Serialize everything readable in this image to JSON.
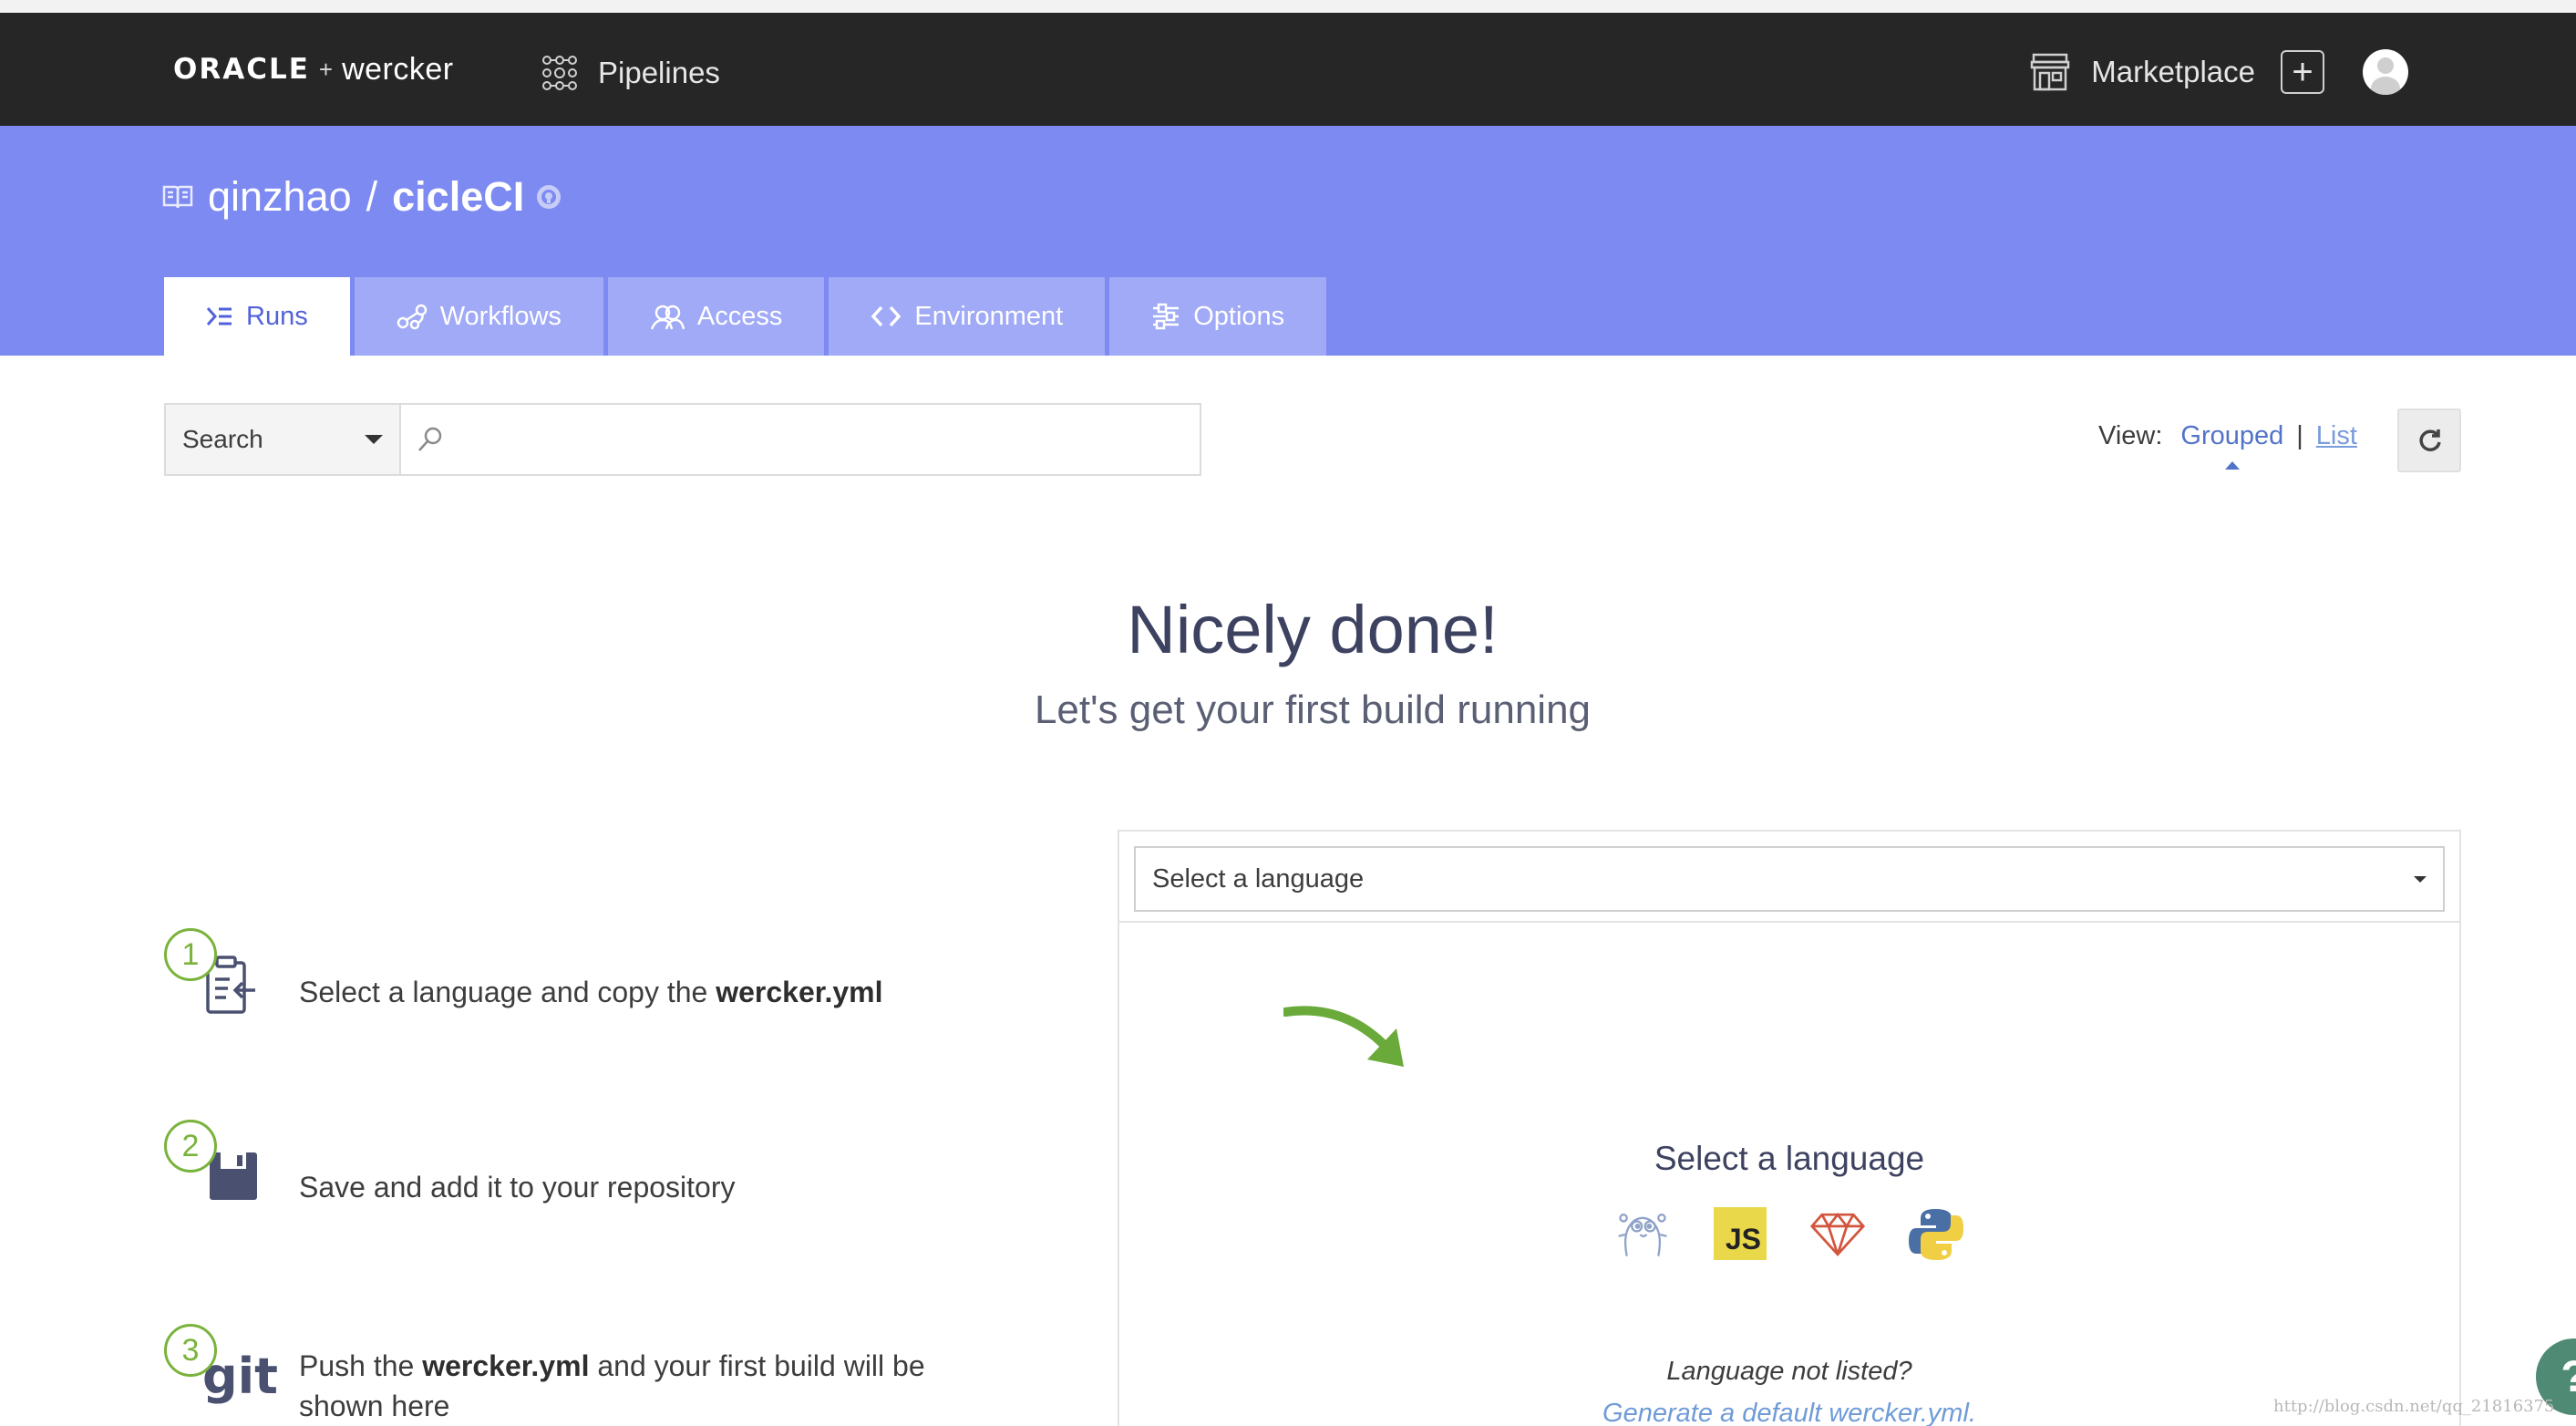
{
  "navbar": {
    "brand_oracle": "ORACLE",
    "brand_plus": "+",
    "brand_wercker": "wercker",
    "pipelines_label": "Pipelines",
    "marketplace_label": "Marketplace",
    "add_symbol": "+"
  },
  "header": {
    "owner": "qinzhao",
    "separator": "/",
    "repo_name": "cicleCI",
    "tabs": [
      {
        "label": "Runs",
        "active": true,
        "icon": "runs-icon"
      },
      {
        "label": "Workflows",
        "active": false,
        "icon": "workflows-icon"
      },
      {
        "label": "Access",
        "active": false,
        "icon": "access-icon"
      },
      {
        "label": "Environment",
        "active": false,
        "icon": "code-brackets-icon"
      },
      {
        "label": "Options",
        "active": false,
        "icon": "sliders-icon"
      }
    ]
  },
  "search": {
    "select_value": "Search",
    "placeholder": ""
  },
  "view": {
    "label": "View:",
    "grouped": "Grouped",
    "separator": "|",
    "list": "List"
  },
  "hero": {
    "title": "Nicely done!",
    "subtitle": "Let's get your first build running"
  },
  "steps": [
    {
      "number": "1",
      "text_before": "Select a language and copy the ",
      "text_bold": "wercker.yml",
      "text_after": "",
      "icon": "clipboard-icon"
    },
    {
      "number": "2",
      "text_before": "Save and add it to your repository",
      "text_bold": "",
      "text_after": "",
      "icon": "save-icon"
    },
    {
      "number": "3",
      "text_before": "Push the ",
      "text_bold": "wercker.yml",
      "text_after": " and your first build will be",
      "text_line2": "shown here",
      "icon": "git-icon",
      "icon_text": "git"
    }
  ],
  "panel": {
    "select_value": "Select a language",
    "title": "Select a language",
    "languages": [
      {
        "name": "Go",
        "icon": "gopher-icon"
      },
      {
        "name": "JavaScript",
        "icon": "js-icon",
        "icon_text": "JS"
      },
      {
        "name": "Ruby",
        "icon": "ruby-icon"
      },
      {
        "name": "Python",
        "icon": "python-icon"
      }
    ],
    "not_listed": "Language not listed?",
    "generate_link": "Generate a default wercker.yml."
  },
  "help_symbol": "?",
  "watermark": "http://blog.csdn.net/qq_21816375",
  "colors": {
    "navbar": "#262626",
    "header": "#7d8af2",
    "tab_inactive": "#a0aaf6",
    "active_tab_text": "#5262d9",
    "step_green": "#7ab33c",
    "link_blue": "#5273c8"
  }
}
